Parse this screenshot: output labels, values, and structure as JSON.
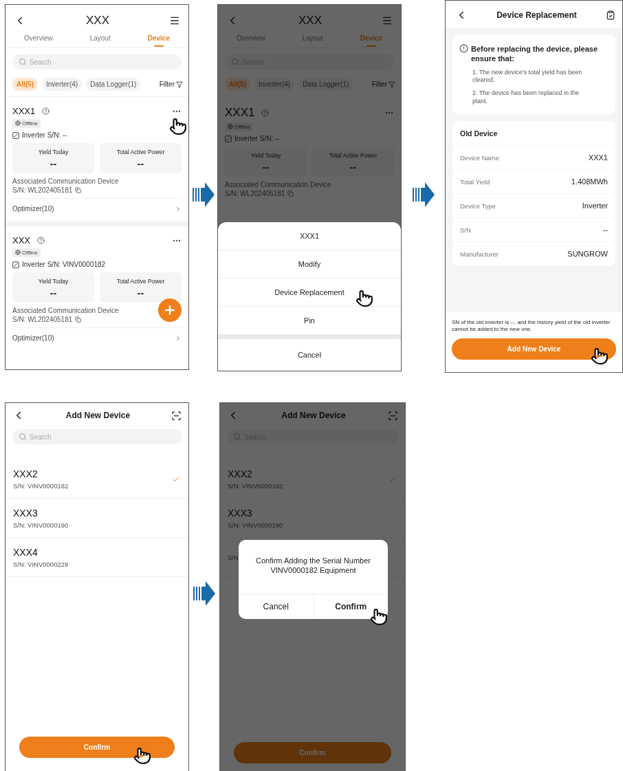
{
  "device_list_screen": {
    "title": "XXX",
    "tabs": [
      {
        "label": "Overview",
        "selected": false
      },
      {
        "label": "Layout",
        "selected": false
      },
      {
        "label": "Device",
        "selected": true
      }
    ],
    "search": {
      "placeholder": "Search"
    },
    "filters": [
      {
        "label": "All(5)",
        "selected": true
      },
      {
        "label": "Inverter(4)",
        "selected": false
      },
      {
        "label": "Data Logger(1)",
        "selected": false
      }
    ],
    "filter_button": "Filter",
    "devices": [
      {
        "name": "XXX1",
        "status": "Offline",
        "serial": "Inverter S/N: --",
        "metrics": [
          {
            "label": "Yield Today",
            "value": "--"
          },
          {
            "label": "Total Active Power",
            "value": "--"
          }
        ],
        "comm_label": "Associated Communication Device",
        "comm_serial": "S/N: WL202405181",
        "optimizer": "Optimizer(10)"
      },
      {
        "name": "XXX",
        "status": "Offline",
        "serial": "Inverter S/N: VINV0000182",
        "metrics": [
          {
            "label": "Yield Today",
            "value": "--"
          },
          {
            "label": "Total Active Power",
            "value": "--"
          }
        ],
        "comm_label": "Associated Communication Device",
        "comm_serial": "S/N: WL202405181",
        "optimizer": "Optimizer(10)"
      }
    ]
  },
  "action_sheet_screen": {
    "title": "XXX",
    "tabs": [
      {
        "label": "Overview",
        "selected": false
      },
      {
        "label": "Layout",
        "selected": false
      },
      {
        "label": "Device",
        "selected": true
      }
    ],
    "search": {
      "placeholder": "Search"
    },
    "filters": [
      {
        "label": "All(5)",
        "selected": true
      },
      {
        "label": "Inverter(4)",
        "selected": false
      },
      {
        "label": "Data Logger(1)",
        "selected": false
      }
    ],
    "filter_button": "Filter",
    "devices": [
      {
        "name": "XXX1",
        "status": "Offline",
        "serial": "Inverter S/N: --",
        "metrics": [
          {
            "label": "Yield Today",
            "value": "--"
          },
          {
            "label": "Total Active Power",
            "value": "--"
          }
        ],
        "comm_label": "Associated Communication Device",
        "comm_serial": "S/N: WL202405181"
      }
    ],
    "sheet": {
      "title": "XXX1",
      "actions": [
        "Modify",
        "Device Replacement",
        "Pin"
      ],
      "cancel": "Cancel"
    }
  },
  "replacement_screen": {
    "title": "Device Replacement",
    "notice": {
      "heading": "Before replacing the device, please ensure that:",
      "items": [
        "1. The new device's total yield has been cleared;",
        "2. The device has been replaced in the plant."
      ]
    },
    "old_device": {
      "title": "Old Device",
      "rows": [
        {
          "label": "Device Name",
          "value": "XXX1"
        },
        {
          "label": "Total Yield",
          "value": "1.408MWh"
        },
        {
          "label": "Device Type",
          "value": "Inverter"
        },
        {
          "label": "S/N",
          "value": "--"
        },
        {
          "label": "Manufacturer",
          "value": "SUNGROW"
        }
      ]
    },
    "note": "SN of the old inverter is --, and the history yield of the old inverter cannot be added to the new one.",
    "button": "Add New Device"
  },
  "add_device_screen": {
    "title": "Add New Device",
    "search": {
      "placeholder": "Search"
    },
    "devices": [
      {
        "name": "XXX2",
        "serial": "S/N: VINV0000182",
        "selected": true
      },
      {
        "name": "XXX3",
        "serial": "S/N: VINV0000190",
        "selected": false
      },
      {
        "name": "XXX4",
        "serial": "S/N: VINV0000229",
        "selected": false
      }
    ],
    "button": "Confirm"
  },
  "confirm_screen": {
    "title": "Add New Device",
    "search": {
      "placeholder": "Search"
    },
    "devices": [
      {
        "name": "XXX2",
        "serial": "S/N: VINV0000182",
        "selected": true
      },
      {
        "name": "XXX3",
        "serial": "S/N: VINV0000190",
        "selected": false
      },
      {
        "serial": "S/N",
        "selected": false
      }
    ],
    "dialog": {
      "message": "Confirm Adding the Serial Number VINV0000182 Equipment",
      "cancel": "Cancel",
      "confirm": "Confirm"
    },
    "button": "Confirm"
  }
}
